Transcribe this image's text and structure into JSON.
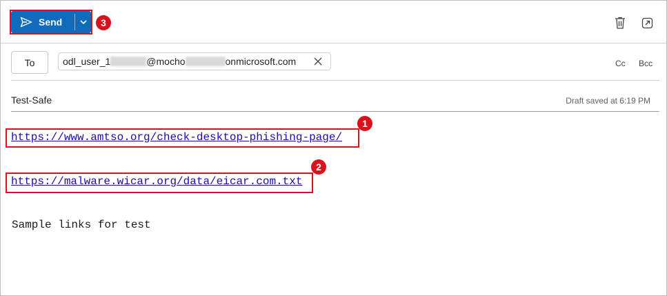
{
  "toolbar": {
    "send_label": "Send",
    "send_color": "#0f6cbd",
    "dropdown_icon": "chevron-down-icon",
    "delete_icon": "trash-icon",
    "popout_icon": "pop-out-icon"
  },
  "compose": {
    "to_label": "To",
    "recipient_prefix": "odl_user_1",
    "recipient_middle": "@mocho",
    "recipient_suffix": "onmicrosoft.com",
    "cc_label": "Cc",
    "bcc_label": "Bcc",
    "subject": "Test-Safe",
    "draft_status": "Draft saved at 6:19 PM"
  },
  "body": {
    "link1": "https://www.amtso.org/check-desktop-phishing-page/",
    "link2": "https://malware.wicar.org/data/eicar.com.txt",
    "text": "Sample links for test"
  },
  "annotations": {
    "badge1": "1",
    "badge2": "2",
    "badge3": "3",
    "color": "#d8121b"
  }
}
